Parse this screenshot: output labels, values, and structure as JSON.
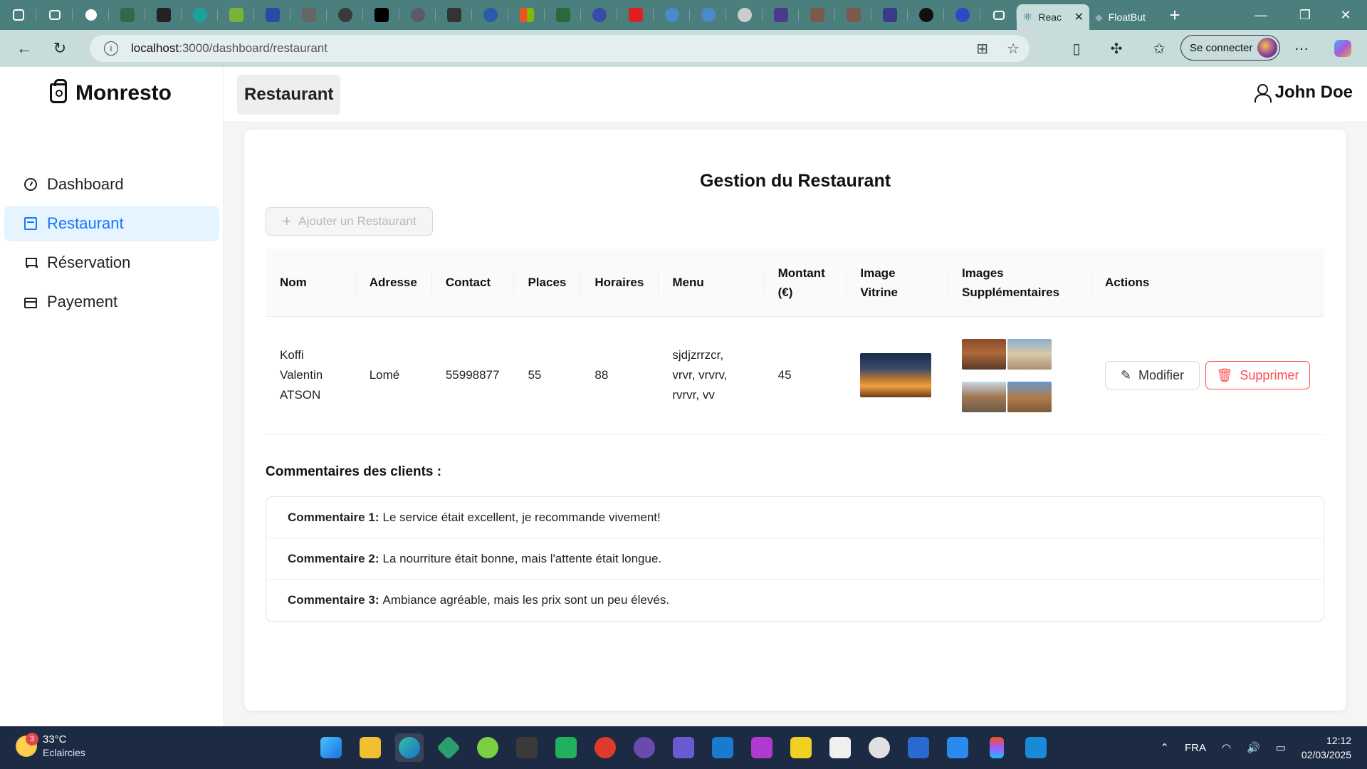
{
  "browser": {
    "tabs": [
      {
        "title": "Reac",
        "active": true
      },
      {
        "title": "FloatBut",
        "active": false
      }
    ],
    "url_host": "localhost",
    "url_path": ":3000/dashboard/restaurant",
    "signin_label": "Se connecter"
  },
  "app": {
    "logo": "Monresto",
    "menu": [
      {
        "label": "Dashboard",
        "icon": "dashboard-icon",
        "active": false
      },
      {
        "label": "Restaurant",
        "icon": "shop-icon",
        "active": true
      },
      {
        "label": "Réservation",
        "icon": "cart-icon",
        "active": false
      },
      {
        "label": "Payement",
        "icon": "credit-card-icon",
        "active": false
      }
    ],
    "header_title": "Restaurant",
    "user_name": "John Doe"
  },
  "page": {
    "title": "Gestion du Restaurant",
    "add_button": "Ajouter un Restaurant",
    "columns": [
      "Nom",
      "Adresse",
      "Contact",
      "Places",
      "Horaires",
      "Menu",
      "Montant (€)",
      "Image Vitrine",
      "Images Supplémentaires",
      "Actions"
    ],
    "rows": [
      {
        "nom": "Koffi Valentin ATSON",
        "adresse": "Lomé",
        "contact": "55998877",
        "places": "55",
        "horaires": "88",
        "menu": "sjdjzrrzcr, vrvr, vrvrv, rvrvr, vv",
        "montant": "45"
      }
    ],
    "edit_label": "Modifier",
    "delete_label": "Supprimer",
    "comments_title": "Commentaires des clients :",
    "comments": [
      {
        "label": "Commentaire 1:",
        "text": "Le service était excellent, je recommande vivement!"
      },
      {
        "label": "Commentaire 2:",
        "text": "La nourriture était bonne, mais l'attente était longue."
      },
      {
        "label": "Commentaire 3:",
        "text": "Ambiance agréable, mais les prix sont un peu élevés."
      }
    ]
  },
  "taskbar": {
    "weather_temp": "33°C",
    "weather_desc": "Eclaircies",
    "weather_badge": "3",
    "lang": "FRA",
    "time": "12:12",
    "date": "02/03/2025"
  },
  "colors": {
    "accent": "#1677ff",
    "danger": "#ff4d4f",
    "tabbar": "#4a7f7d",
    "addressbar": "#c7dcdb",
    "taskbar": "#1d2a44"
  }
}
